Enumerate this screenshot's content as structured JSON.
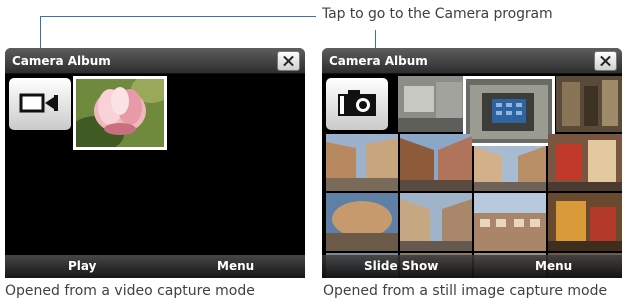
{
  "callout": {
    "text": "Tap to go to the Camera program"
  },
  "video_mode": {
    "title": "Camera Album",
    "left_softkey": "Play",
    "right_softkey": "Menu",
    "camera_button_icon": "video-camera-icon",
    "caption": "Opened from a video capture mode"
  },
  "still_mode": {
    "title": "Camera Album",
    "left_softkey": "Slide Show",
    "right_softkey": "Menu",
    "camera_button_icon": "still-camera-icon",
    "caption": "Opened from a still image capture mode"
  },
  "colors": {
    "callout_line": "#3e6fa6",
    "callout_dot": "#1d56a0",
    "caption_text": "#404040"
  }
}
